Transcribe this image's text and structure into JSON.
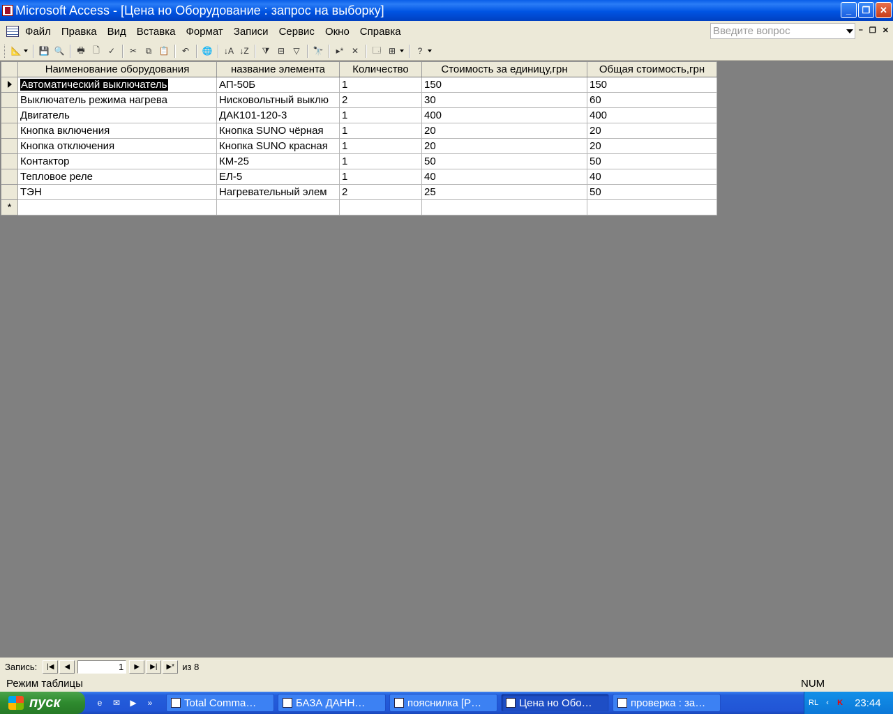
{
  "window": {
    "title": "Microsoft Access - [Цена но Оборудование : запрос на выборку]",
    "controls": {
      "minimize": "_",
      "restore": "❐",
      "close": "✕"
    }
  },
  "menu": {
    "items": [
      {
        "label": "Файл"
      },
      {
        "label": "Правка"
      },
      {
        "label": "Вид"
      },
      {
        "label": "Вставка"
      },
      {
        "label": "Формат"
      },
      {
        "label": "Записи"
      },
      {
        "label": "Сервис"
      },
      {
        "label": "Окно"
      },
      {
        "label": "Справка"
      }
    ],
    "ask_placeholder": "Введите вопрос",
    "mdi_controls": {
      "minimize": "–",
      "restore": "❐",
      "close": "✕"
    }
  },
  "toolbar": {
    "icons": [
      "view-icon",
      "save-icon",
      "print-preview-icon",
      "print-icon",
      "search-file-icon",
      "spelling-icon",
      "cut-icon",
      "copy-icon",
      "paste-icon",
      "undo-icon",
      "hyperlink-icon",
      "sort-ascending-icon",
      "sort-descending-icon",
      "filter-by-selection-icon",
      "filter-by-form-icon",
      "apply-filter-icon",
      "find-icon",
      "new-record-icon",
      "delete-record-icon",
      "database-window-icon",
      "new-object-icon",
      "help-icon"
    ]
  },
  "datasheet": {
    "columns": [
      "Наименование оборудования",
      "название элемента",
      "Количество",
      "Стоимость за единицу,грн",
      "Общая стоимость,грн"
    ],
    "rows": [
      [
        "Автоматический выключатель",
        "АП-50Б",
        "1",
        "150",
        "150"
      ],
      [
        "Выключатель режима нагрева",
        "Нисковольтный выклю",
        "2",
        "30",
        "60"
      ],
      [
        "Двигатель",
        "ДАК101-120-3",
        "1",
        "400",
        "400"
      ],
      [
        "Кнопка включения",
        "Кнопка SUNO чёрная",
        "1",
        "20",
        "20"
      ],
      [
        "Кнопка отключения",
        "Кнопка SUNO красная",
        "1",
        "20",
        "20"
      ],
      [
        "Контактор",
        "КМ-25",
        "1",
        "50",
        "50"
      ],
      [
        "Тепловое реле",
        "ЕЛ-5",
        "1",
        "40",
        "40"
      ],
      [
        "ТЭН",
        "Нагревательный элем",
        "2",
        "25",
        "50"
      ]
    ],
    "new_row_marker": "*",
    "current_row": 0
  },
  "navigator": {
    "label": "Запись:",
    "current": "1",
    "of_label": "из 8"
  },
  "statusbar": {
    "mode": "Режим таблицы",
    "num": "NUM"
  },
  "taskbar": {
    "start_label": "пуск",
    "tasks": [
      {
        "label": "Total Comma…",
        "active": false
      },
      {
        "label": "БАЗА ДАНН…",
        "active": false
      },
      {
        "label": "пояснилка [Р…",
        "active": false
      },
      {
        "label": "Цена но Обо…",
        "active": true
      },
      {
        "label": "проверка : за…",
        "active": false
      }
    ],
    "tray": {
      "lang": "RL",
      "clock": "23:44"
    }
  }
}
